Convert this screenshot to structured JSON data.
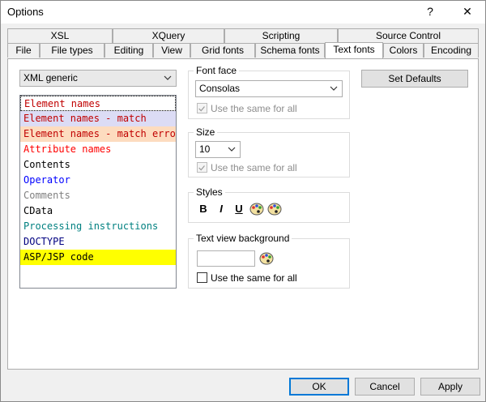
{
  "window": {
    "title": "Options",
    "help_label": "?",
    "close_label": "✕"
  },
  "tabs": {
    "row1": [
      {
        "label": "XSL"
      },
      {
        "label": "XQuery"
      },
      {
        "label": "Scripting"
      },
      {
        "label": "Source Control"
      }
    ],
    "row2": [
      {
        "label": "File"
      },
      {
        "label": "File types"
      },
      {
        "label": "Editing"
      },
      {
        "label": "View"
      },
      {
        "label": "Grid fonts"
      },
      {
        "label": "Schema fonts"
      },
      {
        "label": "Text fonts"
      },
      {
        "label": "Colors"
      },
      {
        "label": "Encoding"
      }
    ],
    "active": "Text fonts"
  },
  "profile_select": {
    "value": "XML generic"
  },
  "element_list": {
    "items": [
      {
        "label": "Element names",
        "color": "#c00000",
        "bg": "#ffffff",
        "selected": true
      },
      {
        "label": "Element names - match",
        "color": "#c00000",
        "bg": "#dcdcf5"
      },
      {
        "label": "Element names - match error",
        "color": "#c00000",
        "bg": "#fddcbf"
      },
      {
        "label": "Attribute names",
        "color": "#ff0000",
        "bg": "#ffffff"
      },
      {
        "label": "Contents",
        "color": "#000000",
        "bg": "#ffffff"
      },
      {
        "label": "Operator",
        "color": "#0000ff",
        "bg": "#ffffff"
      },
      {
        "label": "Comments",
        "color": "#808080",
        "bg": "#ffffff"
      },
      {
        "label": "CData",
        "color": "#000000",
        "bg": "#ffffff"
      },
      {
        "label": "Processing instructions",
        "color": "#008080",
        "bg": "#ffffff"
      },
      {
        "label": "DOCTYPE",
        "color": "#000080",
        "bg": "#ffffff"
      },
      {
        "label": "ASP/JSP code",
        "color": "#000000",
        "bg": "#ffff00"
      }
    ]
  },
  "font_face": {
    "label": "Font face",
    "value": "Consolas",
    "same_for_all_label": "Use the same for all",
    "same_for_all_checked": true
  },
  "size": {
    "label": "Size",
    "value": "10",
    "same_for_all_label": "Use the same for all",
    "same_for_all_checked": true
  },
  "styles": {
    "label": "Styles",
    "bold_label": "B",
    "italic_label": "I",
    "underline_label": "U"
  },
  "text_view_background": {
    "label": "Text view background",
    "same_for_all_label": "Use the same for all",
    "same_for_all_checked": false
  },
  "set_defaults_label": "Set Defaults",
  "footer": {
    "ok_label": "OK",
    "cancel_label": "Cancel",
    "apply_label": "Apply"
  }
}
